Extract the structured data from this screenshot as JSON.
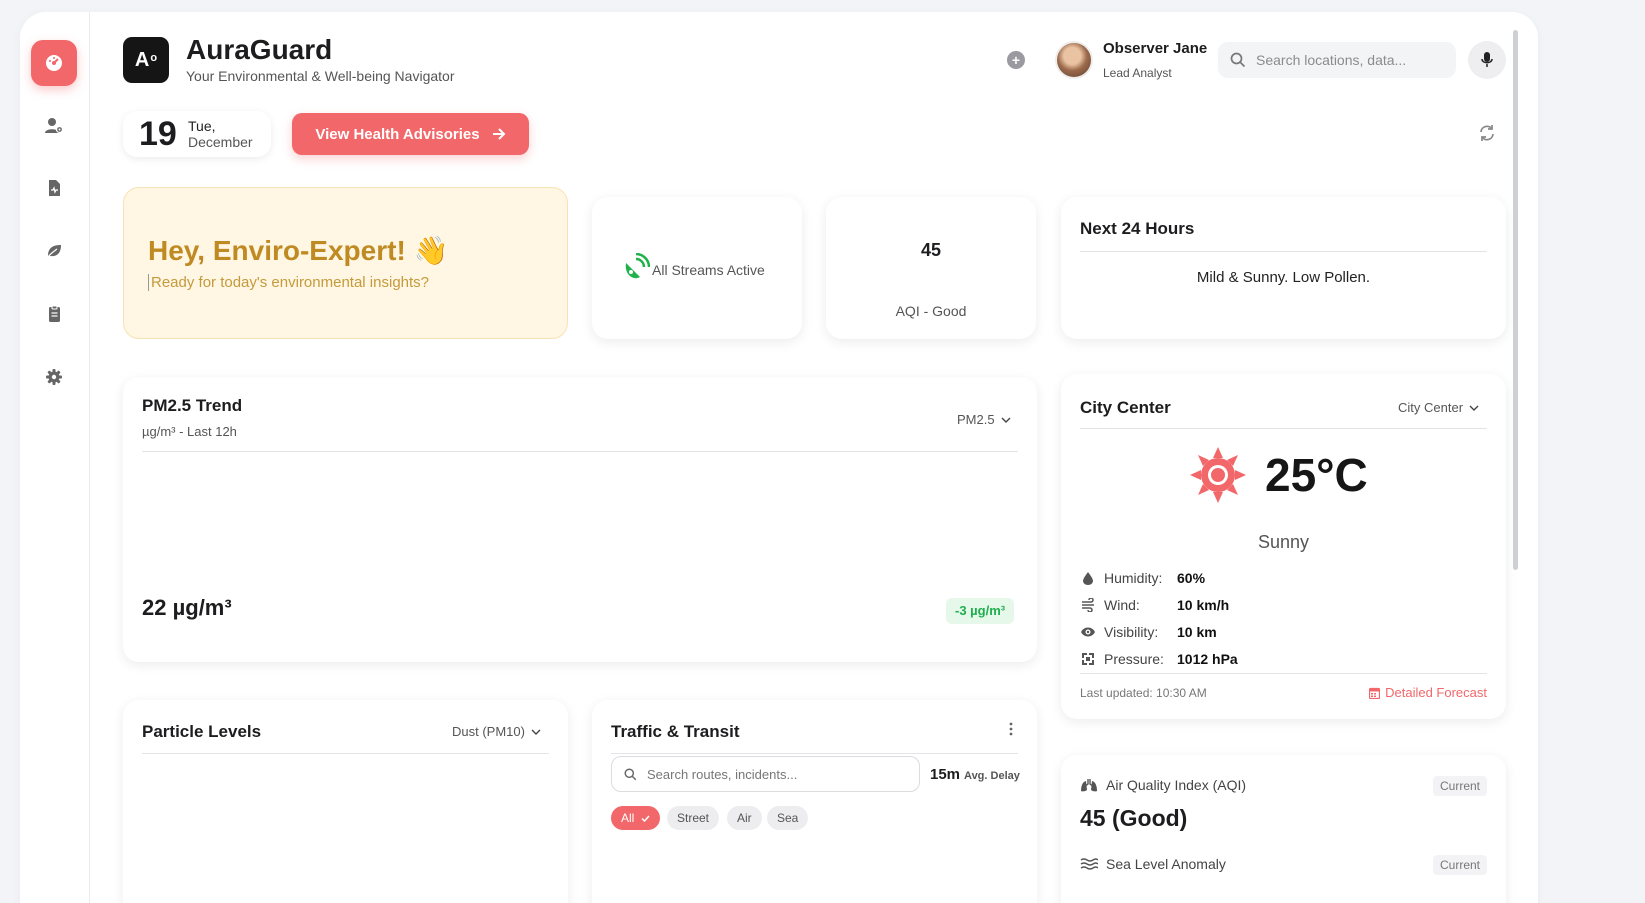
{
  "header": {
    "logo_text": "A",
    "logo_sup": "o",
    "title": "AuraGuard",
    "subtitle": "Your Environmental & Well-being Navigator",
    "user_name": "Observer Jane",
    "user_role": "Lead Analyst",
    "search_placeholder": "Search locations, data..."
  },
  "sidebar": {
    "items": [
      {
        "name": "dashboard",
        "icon": "gauge-icon",
        "active": true
      },
      {
        "name": "users",
        "icon": "user-gear-icon",
        "active": false
      },
      {
        "name": "reports",
        "icon": "file-medical-icon",
        "active": false
      },
      {
        "name": "environment",
        "icon": "leaf-icon",
        "active": false
      },
      {
        "name": "tasks",
        "icon": "clipboard-icon",
        "active": false
      },
      {
        "name": "settings",
        "icon": "gear-icon",
        "active": false
      }
    ]
  },
  "date": {
    "day": "19",
    "weekday": "Tue,",
    "month": "December"
  },
  "advisory_button": "View Health Advisories",
  "welcome": {
    "title": "Hey, Enviro-Expert! 👋",
    "subtitle": "Ready for today's environmental insights?"
  },
  "streams": {
    "label": "All Streams Active"
  },
  "aqi_summary": {
    "value": "45",
    "label": "AQI - Good"
  },
  "next24": {
    "title": "Next 24 Hours",
    "text": "Mild & Sunny. Low Pollen."
  },
  "pm_trend": {
    "title": "PM2.5 Trend",
    "subtitle": "µg/m³ - Last 12h",
    "dropdown": "PM2.5",
    "value": "22 µg/m³",
    "change": "-3 µg/m³"
  },
  "city": {
    "title": "City Center",
    "dropdown": "City Center",
    "temperature": "25°C",
    "condition": "Sunny",
    "metrics": [
      {
        "icon": "droplet-icon",
        "label": "Humidity:",
        "value": "60%"
      },
      {
        "icon": "wind-icon",
        "label": "Wind:",
        "value": "10 km/h"
      },
      {
        "icon": "eye-icon",
        "label": "Visibility:",
        "value": "10 km"
      },
      {
        "icon": "compress-icon",
        "label": "Pressure:",
        "value": "1012 hPa"
      }
    ],
    "updated": "Last updated: 10:30 AM",
    "forecast_link": "Detailed Forecast"
  },
  "particles": {
    "title": "Particle Levels",
    "dropdown": "Dust (PM10)"
  },
  "traffic": {
    "title": "Traffic & Transit",
    "search_placeholder": "Search routes, incidents...",
    "delay_value": "15m",
    "delay_label": "Avg. Delay",
    "chips": [
      "All",
      "Street",
      "Air",
      "Sea"
    ]
  },
  "aqi_panel": {
    "title": "Air Quality Index (AQI)",
    "badge": "Current",
    "value": "45 (Good)",
    "second_title": "Sea Level Anomaly",
    "second_badge": "Current"
  },
  "colors": {
    "accent": "#f2676a",
    "success": "#1fae4d",
    "welcome_bg": "#fff7e3",
    "welcome_text": "#c08a23"
  }
}
